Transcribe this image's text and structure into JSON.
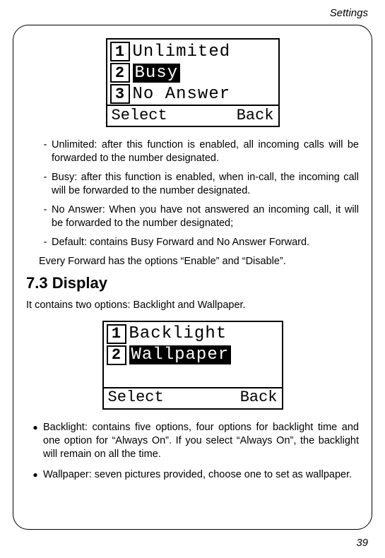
{
  "header": {
    "running": "Settings"
  },
  "page_number": "39",
  "screen1": {
    "items": [
      {
        "num": "1",
        "label": "Unlimited",
        "selected": false
      },
      {
        "num": "2",
        "label": "Busy",
        "selected": true
      },
      {
        "num": "3",
        "label": "No Answer",
        "selected": false
      }
    ],
    "soft_left": "Select",
    "soft_right": "Back"
  },
  "dashes": [
    "Unlimited: after this function is enabled, all incoming calls will be forwarded to the number designated.",
    "Busy: after this function is enabled, when in-call, the incoming call will be forwarded to the number designated.",
    "No Answer: When you have not answered an incoming call, it will be forwarded to the number designated;",
    "Default: contains Busy Forward and No Answer Forward."
  ],
  "every_forward": "Every Forward has the options “Enable” and “Disable”.",
  "section": {
    "num": "7.3",
    "title": "Display"
  },
  "section_intro": "It contains two options: Backlight and Wallpaper.",
  "screen2": {
    "items": [
      {
        "num": "1",
        "label": "Backlight",
        "selected": false
      },
      {
        "num": "2",
        "label": "Wallpaper",
        "selected": true
      }
    ],
    "soft_left": "Select",
    "soft_right": "Back"
  },
  "bullets": [
    "Backlight: contains five options, four options for backlight time and one option for “Always On”. If you select “Always On”, the backlight will remain on all the time.",
    "Wallpaper: seven pictures provided, choose one to set as wallpaper."
  ]
}
